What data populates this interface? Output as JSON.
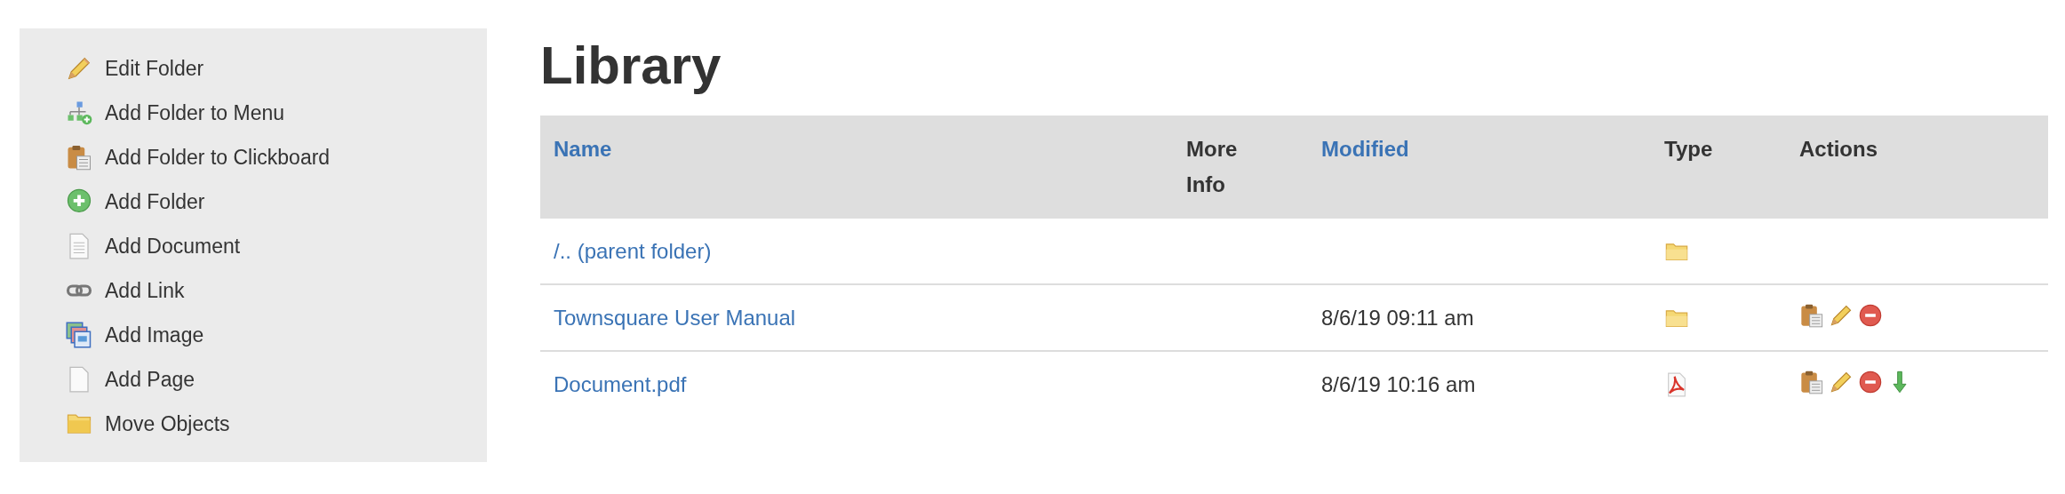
{
  "sidebar": {
    "items": [
      {
        "label": "Edit Folder",
        "kind": "pencil"
      },
      {
        "label": "Add Folder to Menu",
        "kind": "sitemap"
      },
      {
        "label": "Add Folder to Clickboard",
        "kind": "clipboard"
      },
      {
        "label": "Add Folder",
        "kind": "add"
      },
      {
        "label": "Add Document",
        "kind": "document"
      },
      {
        "label": "Add Link",
        "kind": "link"
      },
      {
        "label": "Add Image",
        "kind": "image"
      },
      {
        "label": "Add Page",
        "kind": "page"
      },
      {
        "label": "Move Objects",
        "kind": "folder"
      }
    ]
  },
  "page": {
    "title": "Library"
  },
  "table": {
    "columns": [
      {
        "label": "Name",
        "sortable": true
      },
      {
        "label": "More Info",
        "sortable": false
      },
      {
        "label": "Modified",
        "sortable": true
      },
      {
        "label": "Type",
        "sortable": false
      },
      {
        "label": "Actions",
        "sortable": false
      }
    ],
    "rows": [
      {
        "name": "/.. (parent folder)",
        "modified": "",
        "type": {
          "kind": "folder"
        },
        "actions": []
      },
      {
        "name": "Townsquare User Manual",
        "modified": "8/6/19 09:11 am",
        "type": {
          "kind": "folder"
        },
        "actions": [
          {
            "kind": "clipboard"
          },
          {
            "kind": "pencil"
          },
          {
            "kind": "delete"
          }
        ]
      },
      {
        "name": "Document.pdf",
        "modified": "8/6/19 10:16 am",
        "type": {
          "kind": "pdf"
        },
        "actions": [
          {
            "kind": "clipboard"
          },
          {
            "kind": "pencil"
          },
          {
            "kind": "delete"
          },
          {
            "kind": "download"
          }
        ]
      }
    ]
  }
}
